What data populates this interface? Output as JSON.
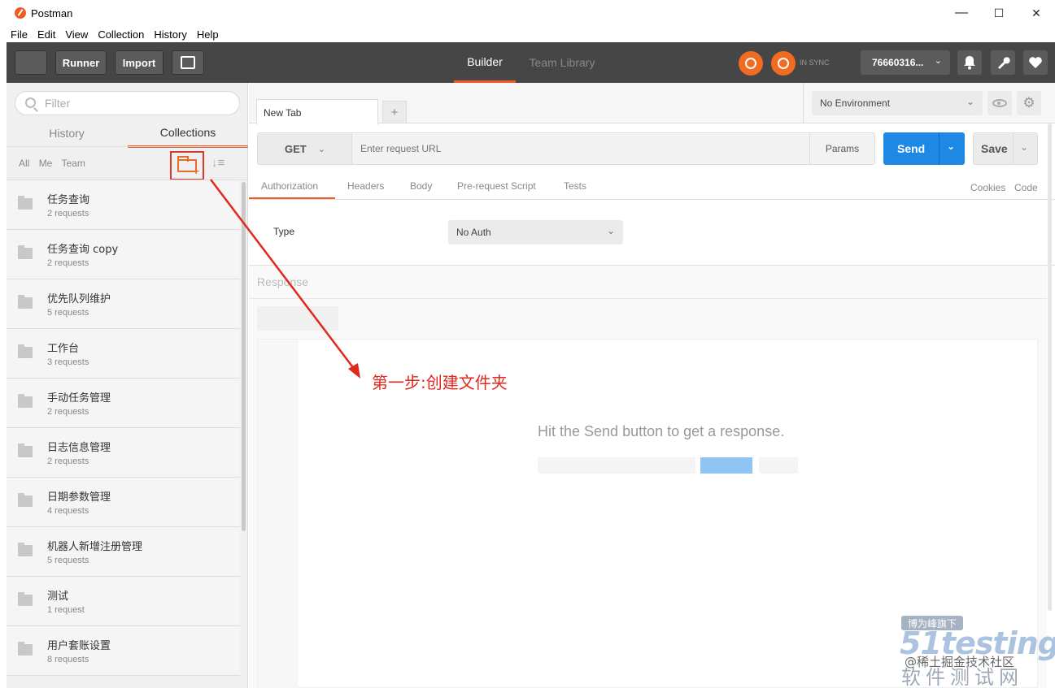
{
  "window": {
    "title": "Postman",
    "minimize": "—",
    "maximize": "☐",
    "close": "✕"
  },
  "menu": [
    "File",
    "Edit",
    "View",
    "Collection",
    "History",
    "Help"
  ],
  "toolbar": {
    "runner": "Runner",
    "import": "Import",
    "tabs": {
      "builder": "Builder",
      "team_library": "Team Library"
    },
    "sync_status": "IN SYNC",
    "user": "76660316...",
    "user_chevron": "⌄"
  },
  "sidebar": {
    "filter_placeholder": "Filter",
    "tabs": {
      "history": "History",
      "collections": "Collections"
    },
    "filters": {
      "all": "All",
      "me": "Me",
      "team": "Team"
    },
    "sort_icon": "↓≡",
    "collections": [
      {
        "name": "任务查询",
        "count": "2 requests"
      },
      {
        "name": "任务查询 copy",
        "count": "2 requests"
      },
      {
        "name": "优先队列维护",
        "count": "5 requests"
      },
      {
        "name": "工作台",
        "count": "3 requests"
      },
      {
        "name": "手动任务管理",
        "count": "2 requests"
      },
      {
        "name": "日志信息管理",
        "count": "2 requests"
      },
      {
        "name": "日期参数管理",
        "count": "4 requests"
      },
      {
        "name": "机器人新增注册管理",
        "count": "5 requests"
      },
      {
        "name": "测试",
        "count": "1 request"
      },
      {
        "name": "用户套账设置",
        "count": "8 requests"
      }
    ]
  },
  "request": {
    "tab_label": "New Tab",
    "add_tab": "+",
    "environment": "No Environment",
    "method": "GET",
    "url_placeholder": "Enter request URL",
    "params": "Params",
    "send": "Send",
    "save": "Save",
    "tabs": {
      "authorization": "Authorization",
      "headers": "Headers",
      "body": "Body",
      "pre_request": "Pre-request Script",
      "tests": "Tests"
    },
    "links": {
      "cookies": "Cookies",
      "code": "Code"
    },
    "auth_type_label": "Type",
    "auth_type_value": "No Auth"
  },
  "response": {
    "label": "Response",
    "hint": "Hit the Send button to get a response."
  },
  "annotation": {
    "text": "第一步:创建文件夹",
    "color": "#e0281e"
  },
  "watermark": {
    "badge": "博为峰旗下",
    "logo": "51testing",
    "handle": "@稀土掘金技术社区",
    "site": "软件测试网"
  },
  "colors": {
    "accent": "#ef5b25",
    "send_blue": "#1e88e5",
    "toolbar_dark": "#464646"
  }
}
